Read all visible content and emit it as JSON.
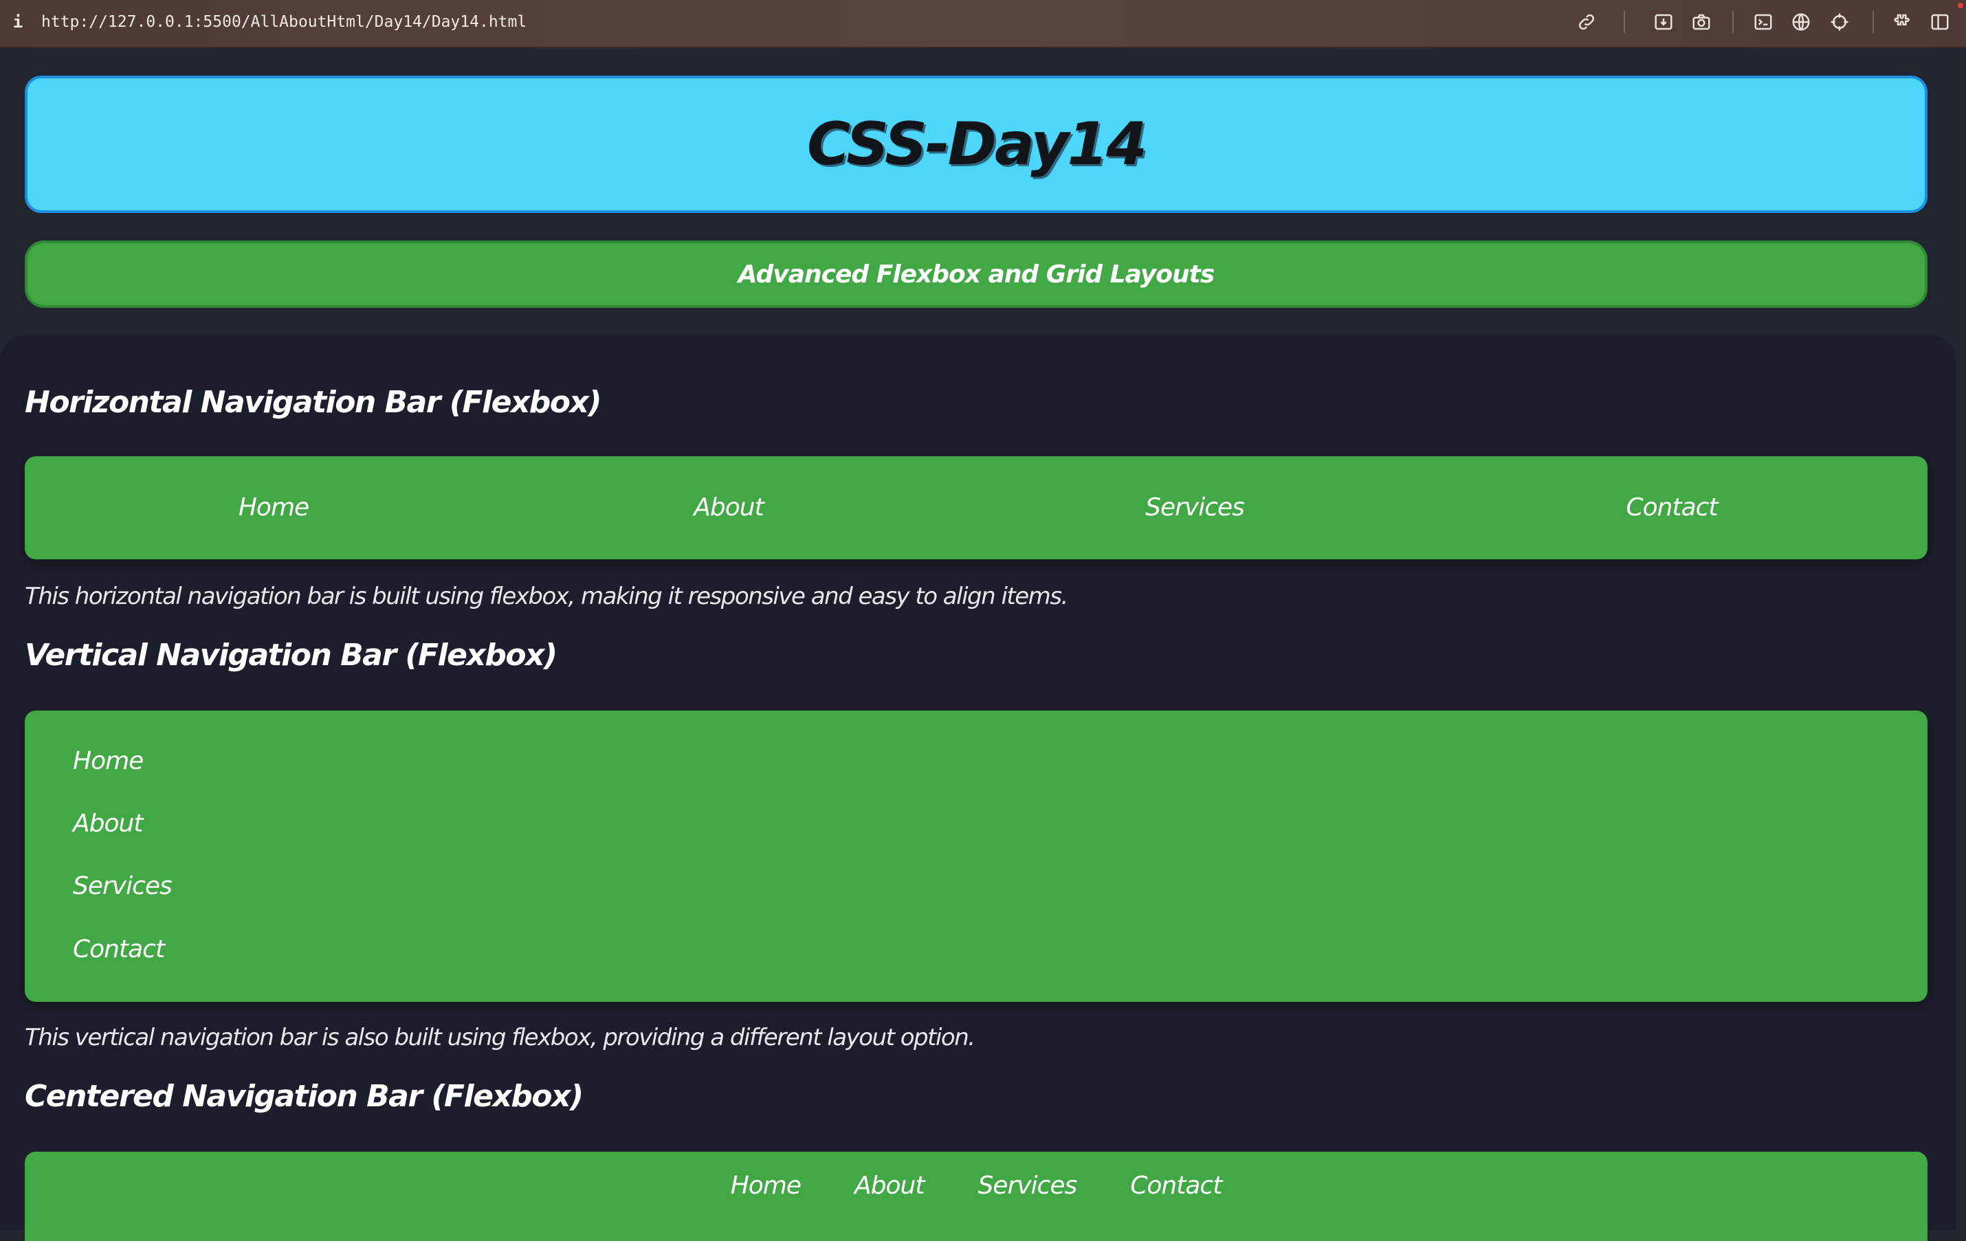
{
  "browser": {
    "info_glyph": "i",
    "url": "http://127.0.0.1:5500/AllAboutHtml/Day14/Day14.html",
    "toolbar_icons": [
      "link-icon",
      "download-screenshot-icon",
      "camera-icon",
      "terminal-icon",
      "globe-icon",
      "crosshair-icon",
      "extensions-icon",
      "sidebar-icon"
    ]
  },
  "header": {
    "title": "CSS-Day14",
    "subtitle": "Advanced Flexbox and Grid Layouts"
  },
  "sections": {
    "horizontal": {
      "heading": "Horizontal Navigation Bar (Flexbox)",
      "links": [
        "Home",
        "About",
        "Services",
        "Contact"
      ],
      "description": "This horizontal navigation bar is built using flexbox, making it responsive and easy to align items."
    },
    "vertical": {
      "heading": "Vertical Navigation Bar (Flexbox)",
      "links": [
        "Home",
        "About",
        "Services",
        "Contact"
      ],
      "description": "This vertical navigation bar is also built using flexbox, providing a different layout option."
    },
    "centered": {
      "heading": "Centered Navigation Bar (Flexbox)",
      "links": [
        "Home",
        "About",
        "Services",
        "Contact"
      ]
    }
  },
  "colors": {
    "header_bg": "#4dd5fa",
    "nav_green": "#42a845",
    "page_bg": "#1c1e2b"
  }
}
